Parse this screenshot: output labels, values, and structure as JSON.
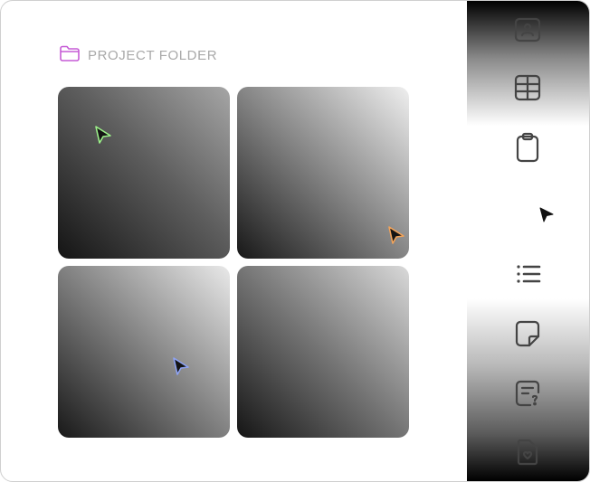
{
  "folder": {
    "icon": "folder-icon",
    "title": "PROJECT FOLDER",
    "accent": "#c65bd6"
  },
  "tiles": [
    {
      "cursor_icon": "cursor-green-icon",
      "cursor_color": "#9df28a"
    },
    {
      "cursor_icon": "cursor-orange-icon",
      "cursor_color": "#f2a35a"
    },
    {
      "cursor_icon": "cursor-blue-icon",
      "cursor_color": "#8ea3f5"
    },
    {
      "cursor_icon": "none"
    }
  ],
  "sidebar": {
    "items": [
      {
        "icon": "contact-card-icon"
      },
      {
        "icon": "table-icon"
      },
      {
        "icon": "clipboard-icon"
      },
      {
        "icon": "list-icon"
      },
      {
        "icon": "note-icon"
      },
      {
        "icon": "help-document-icon"
      },
      {
        "icon": "document-heart-icon"
      }
    ],
    "pointer_icon": "cursor-black-icon"
  }
}
